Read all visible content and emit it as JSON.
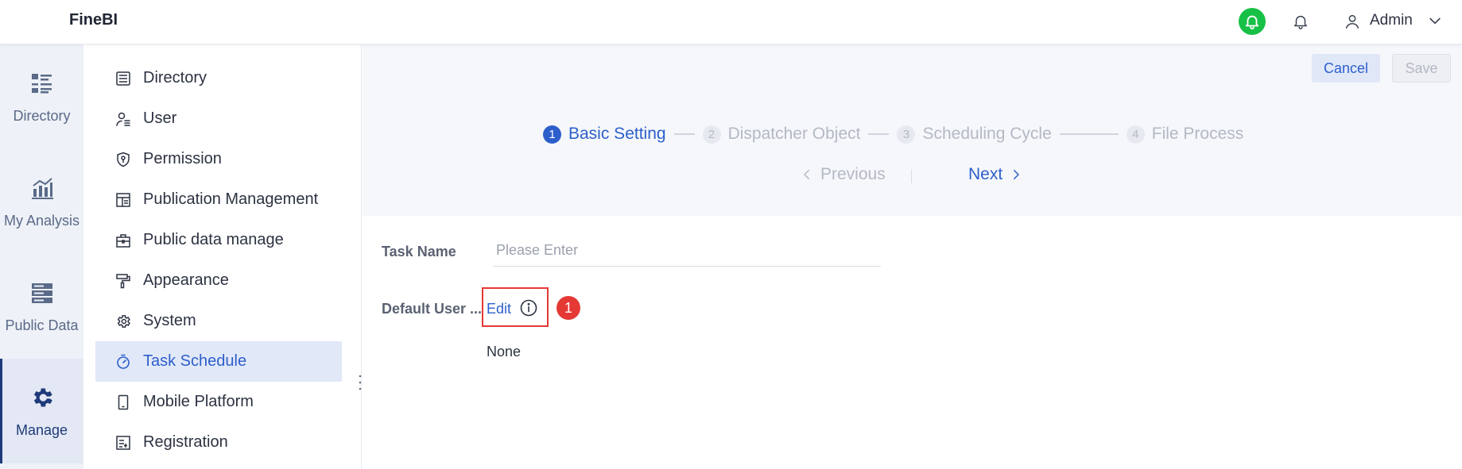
{
  "app": {
    "brand": "FineBI"
  },
  "topbar": {
    "user_name": "Admin"
  },
  "rail": {
    "items": [
      {
        "label": "Directory",
        "icon": "directory-icon"
      },
      {
        "label": "My Analysis",
        "icon": "analysis-chart-icon"
      },
      {
        "label": "Public Data",
        "icon": "database-icon"
      },
      {
        "label": "Manage",
        "icon": "gear-icon",
        "active": true
      }
    ]
  },
  "menu": {
    "items": [
      {
        "label": "Directory",
        "icon": "list-icon"
      },
      {
        "label": "User",
        "icon": "user-icon"
      },
      {
        "label": "Permission",
        "icon": "shield-icon"
      },
      {
        "label": "Publication Management",
        "icon": "layout-icon"
      },
      {
        "label": "Public data manage",
        "icon": "briefcase-icon"
      },
      {
        "label": "Appearance",
        "icon": "paint-roller-icon"
      },
      {
        "label": "System",
        "icon": "gear-icon"
      },
      {
        "label": "Task Schedule",
        "icon": "timer-icon",
        "active": true
      },
      {
        "label": "Mobile Platform",
        "icon": "mobile-icon"
      },
      {
        "label": "Registration",
        "icon": "registration-icon"
      }
    ]
  },
  "toolbar": {
    "cancel_label": "Cancel",
    "save_label": "Save"
  },
  "steps": [
    {
      "num": "1",
      "label": "Basic Setting",
      "active": true
    },
    {
      "num": "2",
      "label": "Dispatcher Object"
    },
    {
      "num": "3",
      "label": "Scheduling Cycle"
    },
    {
      "num": "4",
      "label": "File Process"
    }
  ],
  "nav": {
    "previous_label": "Previous",
    "next_label": "Next"
  },
  "form": {
    "task_name_label": "Task Name",
    "task_name_placeholder": "Please Enter",
    "task_name_value": "",
    "default_user_label": "Default User ...",
    "edit_label": "Edit",
    "default_user_value": "None",
    "annotation_badge": "1"
  },
  "colors": {
    "accent": "#2d5fcb",
    "notify_green": "#17c046",
    "annotation_red": "#e53935",
    "rail_bg": "#eef1f7"
  }
}
